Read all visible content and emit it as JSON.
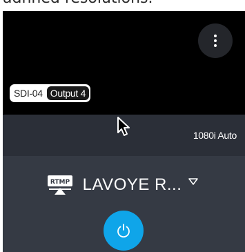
{
  "header_text": "adhned resolutions.",
  "video_card": {
    "source_label": "SDI-04",
    "output_label": "Output 4",
    "resolution": "1080i Auto",
    "menu_icon": "more-vertical-icon"
  },
  "destination": {
    "icon": "rtmp-icon",
    "name": "LAVOYE R...",
    "dropdown_icon": "triangle-down-icon"
  },
  "power_button": {
    "icon": "power-icon",
    "color": "#0fa5e9"
  },
  "colors": {
    "video_bg": "#000000",
    "panel_bg": "#2b2f38",
    "bottom_bg": "#353a44",
    "accent": "#0fa5e9"
  }
}
